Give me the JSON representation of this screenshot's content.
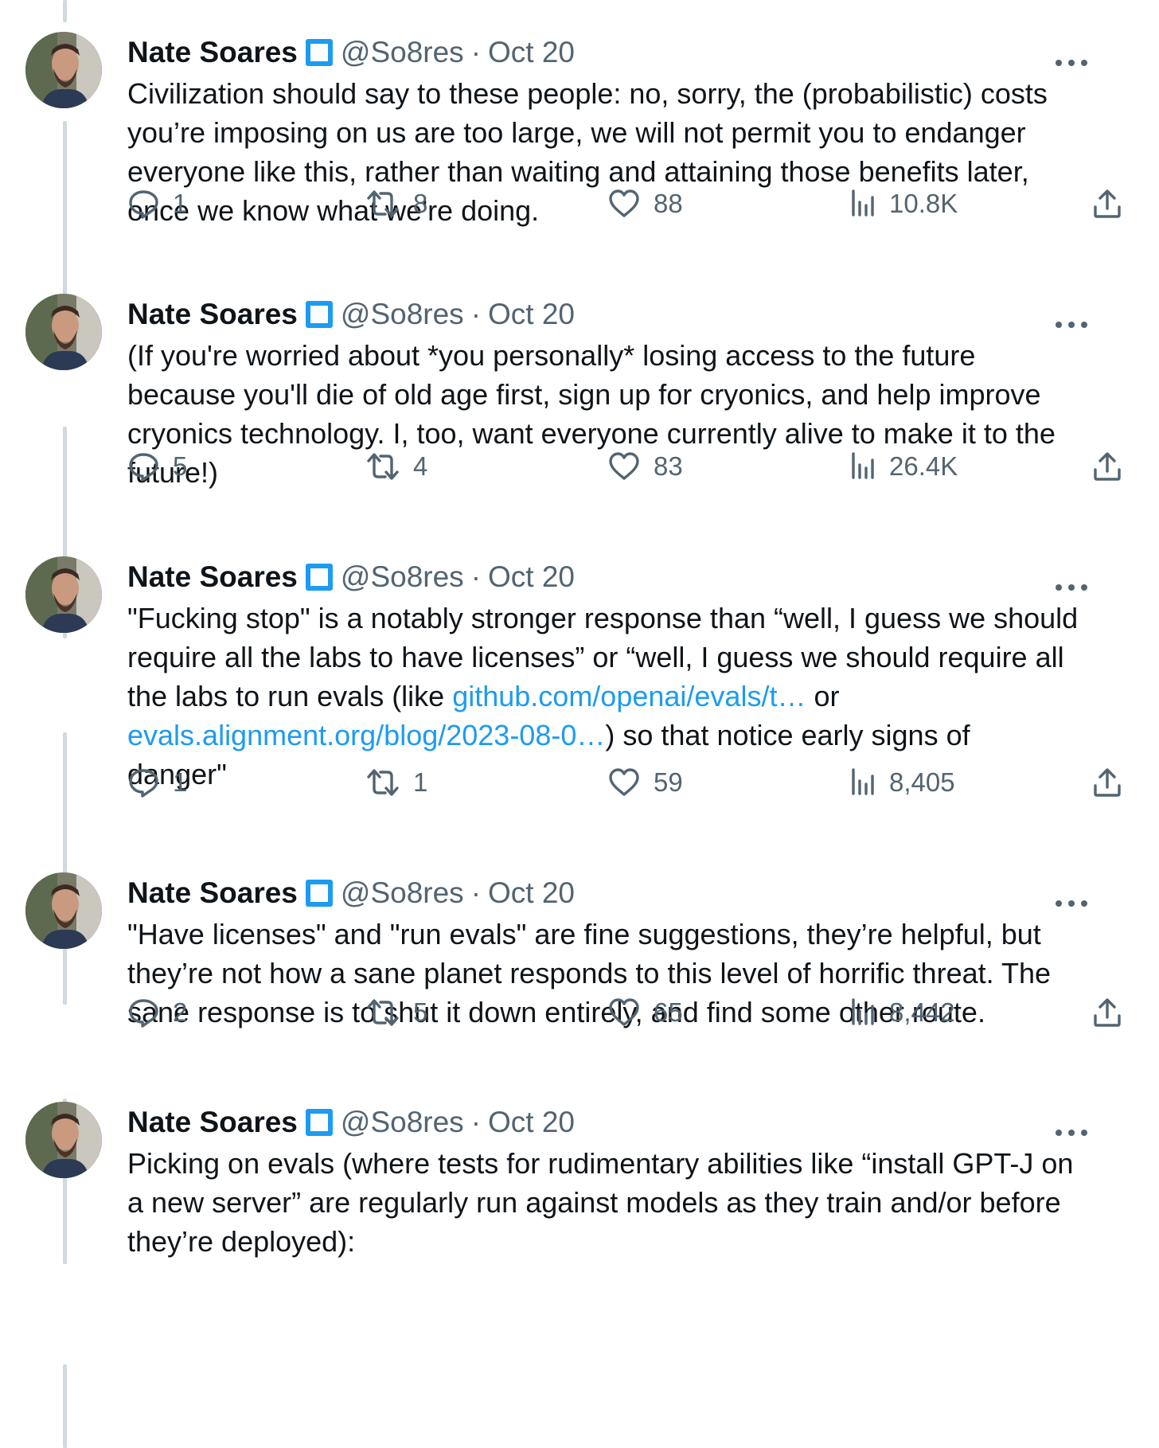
{
  "tweets": [
    {
      "author": "Nate Soares",
      "handle": "@So8res",
      "separator": "·",
      "date": "Oct 20",
      "lines": [
        [
          {
            "t": "Civilization should say to these people: no, sorry, the (probabilistic) costs"
          }
        ],
        [
          {
            "t": "you’re imposing on us are too large, we will not permit you to endanger"
          }
        ],
        [
          {
            "t": "everyone like this, rather than waiting and attaining those benefits later,"
          }
        ],
        [
          {
            "t": "once we know what we're doing."
          }
        ]
      ],
      "replies": "1",
      "retweets": "8",
      "likes": "88",
      "views": "10.8K"
    },
    {
      "author": "Nate Soares",
      "handle": "@So8res",
      "separator": "·",
      "date": "Oct 20",
      "lines": [
        [
          {
            "t": "(If you're worried about *you personally* losing access to the future"
          }
        ],
        [
          {
            "t": "because you'll die of old age first, sign up for cryonics, and help improve"
          }
        ],
        [
          {
            "t": "cryonics technology. I, too, want everyone currently alive to make it to the"
          }
        ],
        [
          {
            "t": "future!)"
          }
        ]
      ],
      "replies": "5",
      "retweets": "4",
      "likes": "83",
      "views": "26.4K"
    },
    {
      "author": "Nate Soares",
      "handle": "@So8res",
      "separator": "·",
      "date": "Oct 20",
      "lines": [
        [
          {
            "t": "\"Fucking stop\" is a notably stronger response than “well, I guess we should"
          }
        ],
        [
          {
            "t": "require all the labs to have licenses” or “well, I guess we should require all"
          }
        ],
        [
          {
            "t": "the labs to run evals (like "
          },
          {
            "t": "github.com/openai/evals/t…",
            "link": true
          },
          {
            "t": " or"
          }
        ],
        [
          {
            "t": "evals.alignment.org/blog/2023-08-0…",
            "link": true
          },
          {
            "t": ") so that notice early signs of"
          }
        ],
        [
          {
            "t": "danger\""
          }
        ]
      ],
      "replies": "1",
      "retweets": "1",
      "likes": "59",
      "views": "8,405"
    },
    {
      "author": "Nate Soares",
      "handle": "@So8res",
      "separator": "·",
      "date": "Oct 20",
      "lines": [
        [
          {
            "t": "\"Have licenses\" and \"run evals\" are fine suggestions, they’re helpful, but"
          }
        ],
        [
          {
            "t": "they’re not how a sane planet responds to this level of horrific threat. The"
          }
        ],
        [
          {
            "t": "sane response is to shut it down entirely, and find some other route."
          }
        ]
      ],
      "replies": "2",
      "retweets": "5",
      "likes": "65",
      "views": "8,442"
    },
    {
      "author": "Nate Soares",
      "handle": "@So8res",
      "separator": "·",
      "date": "Oct 20",
      "lines": [
        [
          {
            "t": "Picking on evals (where tests for rudimentary abilities like “install GPT-J on"
          }
        ],
        [
          {
            "t": "a new server” are regularly run against models as they train and/or before"
          }
        ],
        [
          {
            "t": "they’re deployed):"
          }
        ]
      ]
    }
  ],
  "icons": {
    "reply": "reply-icon",
    "retweet": "retweet-icon",
    "like": "heart-icon",
    "views": "views-icon",
    "share": "share-icon",
    "more": "more-icon",
    "verified": "verified-badge-icon"
  },
  "colors": {
    "text": "#0f1419",
    "secondary": "#536471",
    "link": "#1d9bf0",
    "thread_line": "#cfd9de",
    "badge": "#1d9bf0"
  }
}
